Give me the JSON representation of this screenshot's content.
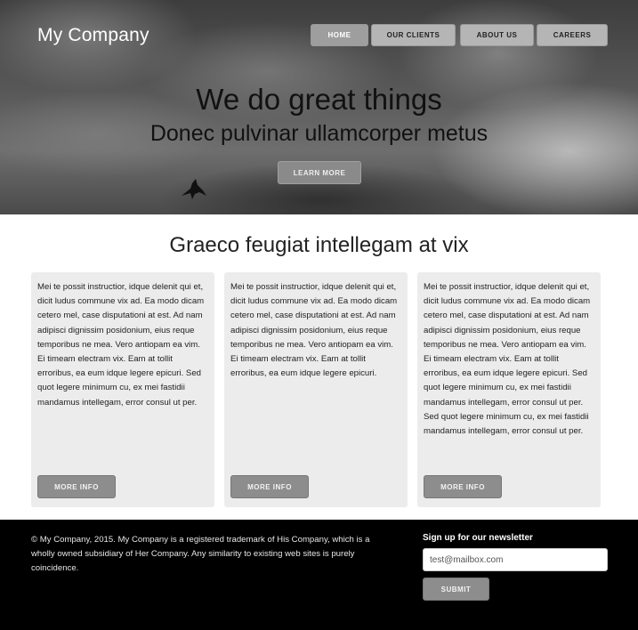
{
  "header": {
    "logo": "My Company",
    "nav": [
      {
        "label": "HOME",
        "active": true
      },
      {
        "label": "OUR CLIENTS",
        "active": false
      },
      {
        "label": "ABOUT US",
        "active": false
      },
      {
        "label": "CAREERS",
        "active": false
      }
    ]
  },
  "hero": {
    "title": "We do great things",
    "subtitle": "Donec pulvinar ullamcorper metus",
    "button_label": "LEARN MORE"
  },
  "main": {
    "section_title": "Graeco feugiat intellegam at vix",
    "cards": [
      {
        "text": "Mei te possit instructior, idque delenit qui et, dicit ludus commune vix ad. Ea modo dicam cetero mel, case disputationi at est. Ad nam adipisci dignissim posidonium, eius reque temporibus ne mea. Vero antiopam ea vim. Ei timeam electram vix. Eam at tollit erroribus, ea eum idque legere epicuri. Sed quot legere minimum cu, ex mei fastidii mandamus intellegam, error consul ut per.",
        "button_label": "MORE INFO"
      },
      {
        "text": "Mei te possit instructior, idque delenit qui et, dicit ludus commune vix ad. Ea modo dicam cetero mel, case disputationi at est. Ad nam adipisci dignissim posidonium, eius reque temporibus ne mea. Vero antiopam ea vim. Ei timeam electram vix. Eam at tollit erroribus, ea eum idque legere epicuri.",
        "button_label": "MORE INFO"
      },
      {
        "text": "Mei te possit instructior, idque delenit qui et, dicit ludus commune vix ad. Ea modo dicam cetero mel, case disputationi at est. Ad nam adipisci dignissim posidonium, eius reque temporibus ne mea. Vero antiopam ea vim. Ei timeam electram vix. Eam at tollit erroribus, ea eum idque legere epicuri. Sed quot legere minimum cu, ex mei fastidii mandamus intellegam, error consul ut per. Sed quot legere minimum cu, ex mei fastidii mandamus intellegam, error consul ut per.",
        "button_label": "MORE INFO"
      }
    ]
  },
  "footer": {
    "copyright": "© My Company, 2015. My Company is a registered trademark of His Company, which is a wholly owned subsidiary of Her Company. Any similarity to existing web sites is purely coincidence.",
    "newsletter_title": "Sign up for our newsletter",
    "email_placeholder": "test@mailbox.com",
    "submit_label": "SUBMIT"
  },
  "colors": {
    "footer_bg": "#000000",
    "card_bg": "#ececec",
    "button_bg": "#8d8d8d"
  }
}
